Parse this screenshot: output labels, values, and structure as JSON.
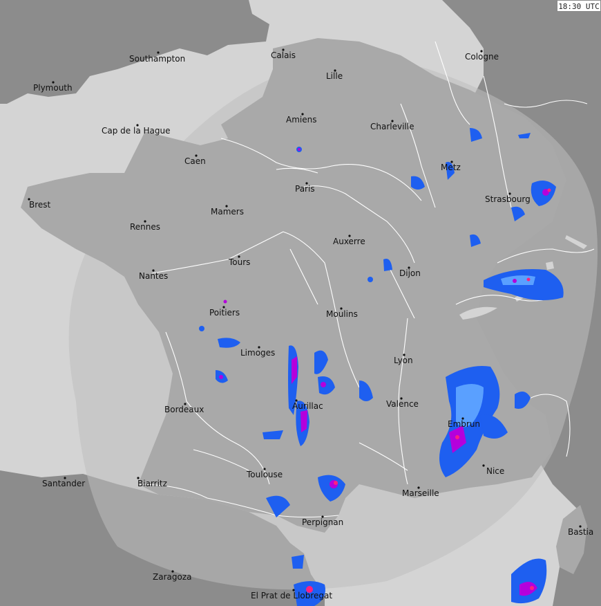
{
  "timestamp": "18:30 UTC",
  "colors": {
    "sea": "#d4d4d4",
    "land_outer": "#8c8c8c",
    "land_inner": "#a8a8a8",
    "coverage": "#b8b8b8",
    "rivers": "#ffffff",
    "borders": "#ffffff",
    "precip_light": "#1e5ff0",
    "precip_moderate": "#5aa0ff",
    "precip_heavy": "#b400dc",
    "precip_extreme": "#ff2080"
  },
  "cities": [
    {
      "name": "Southampton"
    },
    {
      "name": "Plymouth"
    },
    {
      "name": "Calais"
    },
    {
      "name": "Lille"
    },
    {
      "name": "Cologne"
    },
    {
      "name": "Amiens"
    },
    {
      "name": "Charleville"
    },
    {
      "name": "Cap de la Hague"
    },
    {
      "name": "Caen"
    },
    {
      "name": "Metz"
    },
    {
      "name": "Paris"
    },
    {
      "name": "Brest"
    },
    {
      "name": "Strasbourg"
    },
    {
      "name": "Mamers"
    },
    {
      "name": "Rennes"
    },
    {
      "name": "Auxerre"
    },
    {
      "name": "Tours"
    },
    {
      "name": "Dijon"
    },
    {
      "name": "Nantes"
    },
    {
      "name": "Poitiers"
    },
    {
      "name": "Moulins"
    },
    {
      "name": "Limoges"
    },
    {
      "name": "Lyon"
    },
    {
      "name": "Aurillac"
    },
    {
      "name": "Valence"
    },
    {
      "name": "Bordeaux"
    },
    {
      "name": "Embrun"
    },
    {
      "name": "Nice"
    },
    {
      "name": "Santander"
    },
    {
      "name": "Biarritz"
    },
    {
      "name": "Toulouse"
    },
    {
      "name": "Marseille"
    },
    {
      "name": "Perpignan"
    },
    {
      "name": "Bastia"
    },
    {
      "name": "Zaragoza"
    },
    {
      "name": "El Prat de Llobregat"
    }
  ]
}
